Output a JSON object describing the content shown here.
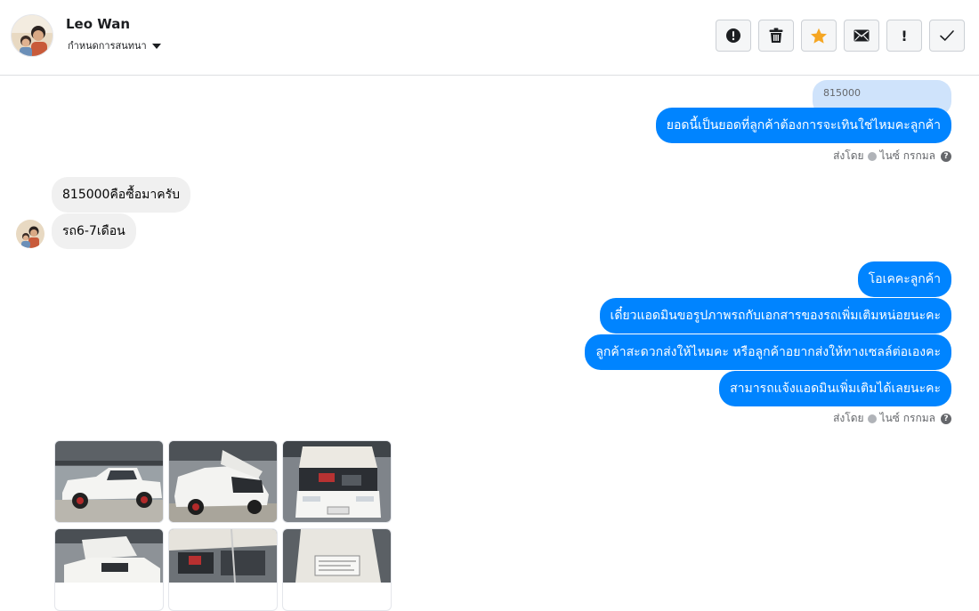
{
  "header": {
    "contact_name": "Leo Wan",
    "status_label": "กำหนดการสนทนา",
    "toolbar": [
      {
        "name": "mark-spam-button",
        "icon": "alert-circle-icon"
      },
      {
        "name": "delete-button",
        "icon": "trash-icon"
      },
      {
        "name": "star-button",
        "icon": "star-icon",
        "color": "#f5a623"
      },
      {
        "name": "mark-unread-button",
        "icon": "envelope-icon"
      },
      {
        "name": "important-button",
        "icon": "exclamation-icon",
        "glyph": "!"
      },
      {
        "name": "mark-done-button",
        "icon": "check-icon"
      }
    ]
  },
  "conversation": {
    "quoted_reply": "815000",
    "outgoing_1": "ยอดนี้เป็นยอดที่ลูกค้าต้องการจะเทินใช่ไหมคะลูกค้า",
    "meta_1": {
      "sent_by": "ส่งโดย",
      "sender": "ไนซ์ กรกมล",
      "help": "?"
    },
    "incoming_1": "815000คือซื้อมาครับ",
    "incoming_2": "รถ6-7เดือน",
    "outgoing_2": "โอเคคะลูกค้า",
    "outgoing_3": "เดี๋ยวแอดมินขอรูปภาพรถกับเอกสารของรถเพิ่มเติมหน่อยนะคะ",
    "outgoing_4": "ลูกค้าสะดวกส่งให้ไหมคะ หรือลูกค้าอยากส่งให้ทางเซลล์ต่อเองคะ",
    "outgoing_5": "สามารถแจ้งแอดมินเพิ่มเติมได้เลยนะคะ",
    "meta_2": {
      "sent_by": "ส่งโดย",
      "sender": "ไนซ์ กรกมล",
      "help": "?"
    },
    "photos": [
      "photo-white-pickup-side",
      "photo-white-pickup-hood-open",
      "photo-engine-bay-front",
      "photo-pickup-hood-open-garage",
      "photo-engine-close-up",
      "photo-vehicle-plate-document"
    ]
  },
  "colors": {
    "outgoing_bubble": "#0084ff",
    "incoming_bubble": "#f0f0f0",
    "quoted_bubble": "#cfe3fb",
    "star": "#f5a623"
  }
}
